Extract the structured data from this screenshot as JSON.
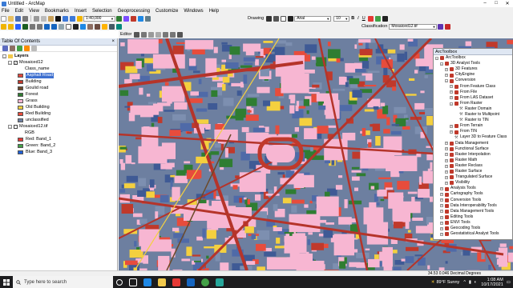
{
  "window": {
    "title": "Untitled - ArcMap",
    "min": "–",
    "max": "□",
    "close": "✕"
  },
  "menu": [
    "File",
    "Edit",
    "View",
    "Bookmarks",
    "Insert",
    "Selection",
    "Geoprocessing",
    "Customize",
    "Windows",
    "Help"
  ],
  "toolbar": {
    "scale": "1:40,000",
    "drawing_label": "Drawing",
    "font": "Arial",
    "font_size": "10",
    "editor_label": "Editor",
    "classification_label": "Classification",
    "classification_layer": "Mosaiced12.tif"
  },
  "toc": {
    "title": "Table Of Contents",
    "close": "×",
    "layers_root": "Layers",
    "layer1": {
      "name": "Mosaiced12",
      "field": "Class_name",
      "classes": [
        {
          "label": "Asphalt Road",
          "color": "#e0463c",
          "selected": true
        },
        {
          "label": "Building",
          "color": "#c0392b"
        },
        {
          "label": "Goulid road",
          "color": "#6b4a2a"
        },
        {
          "label": "Forest",
          "color": "#2f7d32"
        },
        {
          "label": "Grass",
          "color": "#f7b6d2"
        },
        {
          "label": "Old Building",
          "color": "#f4d03f"
        },
        {
          "label": "Red Building",
          "color": "#e74c3c"
        },
        {
          "label": "unclassified",
          "color": "#6d7fa0"
        }
      ]
    },
    "layer2": {
      "name": "Mosaiced12.tif",
      "field": "RGB",
      "bands": [
        {
          "label": "Red:   Band_1",
          "color": "#e53935"
        },
        {
          "label": "Green: Band_2",
          "color": "#43a047"
        },
        {
          "label": "Blue:  Band_3",
          "color": "#1e5fd8"
        }
      ]
    }
  },
  "toolbox": {
    "title": "ArcToolbox",
    "items": [
      {
        "label": "ArcToolbox",
        "indent": 0,
        "exp": "-",
        "icon": "toolbox"
      },
      {
        "label": "3D Analyst Tools",
        "indent": 1,
        "exp": "-",
        "icon": "toolbox"
      },
      {
        "label": "3D Features",
        "indent": 2,
        "exp": "+",
        "icon": "toolbox"
      },
      {
        "label": "CityEngine",
        "indent": 2,
        "exp": "+",
        "icon": "toolbox"
      },
      {
        "label": "Conversion",
        "indent": 2,
        "exp": "-",
        "icon": "toolbox"
      },
      {
        "label": "From Feature Class",
        "indent": 3,
        "exp": "+",
        "icon": "toolbox"
      },
      {
        "label": "From File",
        "indent": 3,
        "exp": "+",
        "icon": "toolbox"
      },
      {
        "label": "From LAS Dataset",
        "indent": 3,
        "exp": "+",
        "icon": "toolbox"
      },
      {
        "label": "From Raster",
        "indent": 3,
        "exp": "-",
        "icon": "toolbox"
      },
      {
        "label": "Raster Domain",
        "indent": 4,
        "exp": "",
        "icon": "tool"
      },
      {
        "label": "Raster to Multipoint",
        "indent": 4,
        "exp": "",
        "icon": "tool"
      },
      {
        "label": "Raster to TIN",
        "indent": 4,
        "exp": "",
        "icon": "tool"
      },
      {
        "label": "From Terrain",
        "indent": 3,
        "exp": "+",
        "icon": "toolbox"
      },
      {
        "label": "From TIN",
        "indent": 3,
        "exp": "+",
        "icon": "toolbox"
      },
      {
        "label": "Layer 3D to Feature Class",
        "indent": 3,
        "exp": "",
        "icon": "tool"
      },
      {
        "label": "Data Management",
        "indent": 2,
        "exp": "+",
        "icon": "toolbox"
      },
      {
        "label": "Functional Surface",
        "indent": 2,
        "exp": "+",
        "icon": "toolbox"
      },
      {
        "label": "Raster Interpolation",
        "indent": 2,
        "exp": "+",
        "icon": "toolbox"
      },
      {
        "label": "Raster Math",
        "indent": 2,
        "exp": "+",
        "icon": "toolbox"
      },
      {
        "label": "Raster Reclass",
        "indent": 2,
        "exp": "+",
        "icon": "toolbox"
      },
      {
        "label": "Raster Surface",
        "indent": 2,
        "exp": "+",
        "icon": "toolbox"
      },
      {
        "label": "Triangulated Surface",
        "indent": 2,
        "exp": "+",
        "icon": "toolbox"
      },
      {
        "label": "Visibility",
        "indent": 2,
        "exp": "+",
        "icon": "toolbox"
      },
      {
        "label": "Analysis Tools",
        "indent": 1,
        "exp": "+",
        "icon": "toolbox"
      },
      {
        "label": "Cartography Tools",
        "indent": 1,
        "exp": "+",
        "icon": "toolbox"
      },
      {
        "label": "Conversion Tools",
        "indent": 1,
        "exp": "+",
        "icon": "toolbox"
      },
      {
        "label": "Data Interoperability Tools",
        "indent": 1,
        "exp": "+",
        "icon": "toolbox"
      },
      {
        "label": "Data Management Tools",
        "indent": 1,
        "exp": "+",
        "icon": "toolbox"
      },
      {
        "label": "Editing Tools",
        "indent": 1,
        "exp": "+",
        "icon": "toolbox"
      },
      {
        "label": "ENVI Tools",
        "indent": 1,
        "exp": "+",
        "icon": "toolbox"
      },
      {
        "label": "Geocoding Tools",
        "indent": 1,
        "exp": "+",
        "icon": "toolbox"
      },
      {
        "label": "Geostatistical Analyst Tools",
        "indent": 1,
        "exp": "+",
        "icon": "toolbox"
      }
    ]
  },
  "status": {
    "coords": "34.53  0.046 Decimal Degrees"
  },
  "taskbar": {
    "search_placeholder": "Type here to search",
    "weather": "89°F  Sunny",
    "time": "1:08 AM",
    "date": "10/17/2021"
  }
}
